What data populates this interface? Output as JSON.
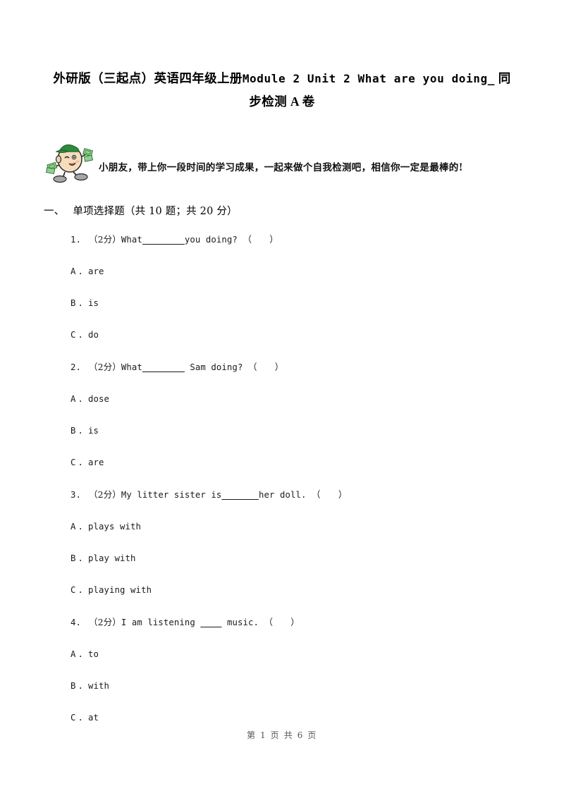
{
  "document": {
    "title_line1": "外研版（三起点）英语四年级上册",
    "title_en": "Module 2 Unit 2 What are you doing_",
    "title_line1_tail": "同",
    "title_line2": "步检测 A 卷"
  },
  "notice": {
    "icon": "egg-mascot-icon",
    "text": "小朋友，带上你一段时间的学习成果，一起来做个自我检测吧，相信你一定是最棒的!"
  },
  "section": {
    "number": "一、",
    "title": "单项选择题（共 10 题；共 20 分）"
  },
  "questions": [
    {
      "index": "1.",
      "score": "（2分）",
      "stem_before": "What",
      "blank": "________",
      "stem_after": "you doing?",
      "answer_bracket": "（　　）",
      "options": [
        {
          "key": "A",
          "dot": ".",
          "text": "are"
        },
        {
          "key": "B",
          "dot": ".",
          "text": "is"
        },
        {
          "key": "C",
          "dot": ".",
          "text": "do"
        }
      ]
    },
    {
      "index": "2.",
      "score": "（2分）",
      "stem_before": "What",
      "blank": "________",
      "stem_after": " Sam doing?",
      "answer_bracket": "（　　）",
      "options": [
        {
          "key": "A",
          "dot": ".",
          "text": "dose"
        },
        {
          "key": "B",
          "dot": ".",
          "text": "is"
        },
        {
          "key": "C",
          "dot": ".",
          "text": "are"
        }
      ]
    },
    {
      "index": "3.",
      "score": "（2分）",
      "stem_before": "My litter sister is",
      "blank": "_______",
      "stem_after": "her doll.",
      "answer_bracket": "（　　）",
      "options": [
        {
          "key": "A",
          "dot": ".",
          "text": "plays with"
        },
        {
          "key": "B",
          "dot": ".",
          "text": "play with"
        },
        {
          "key": "C",
          "dot": ".",
          "text": "playing with"
        }
      ]
    },
    {
      "index": "4.",
      "score": "（2分）",
      "stem_before": "I am listening ",
      "blank": "____",
      "stem_after": " music.",
      "answer_bracket": "（　　）",
      "options": [
        {
          "key": "A",
          "dot": ".",
          "text": "to"
        },
        {
          "key": "B",
          "dot": ".",
          "text": "with"
        },
        {
          "key": "C",
          "dot": ".",
          "text": "at"
        }
      ]
    }
  ],
  "footer": {
    "text": "第 1 页 共 6 页"
  },
  "colors": {
    "page_background": "#ffffff",
    "text": "#000000",
    "body_text": "#1a1a1a",
    "footer_text": "#555555",
    "mascot_cap": "#2e8b3d",
    "mascot_body": "#f3d9b8",
    "mascot_money": "#7ec87e",
    "mascot_shoe": "#9a9a9a",
    "mascot_outline": "#2b2b2b"
  }
}
